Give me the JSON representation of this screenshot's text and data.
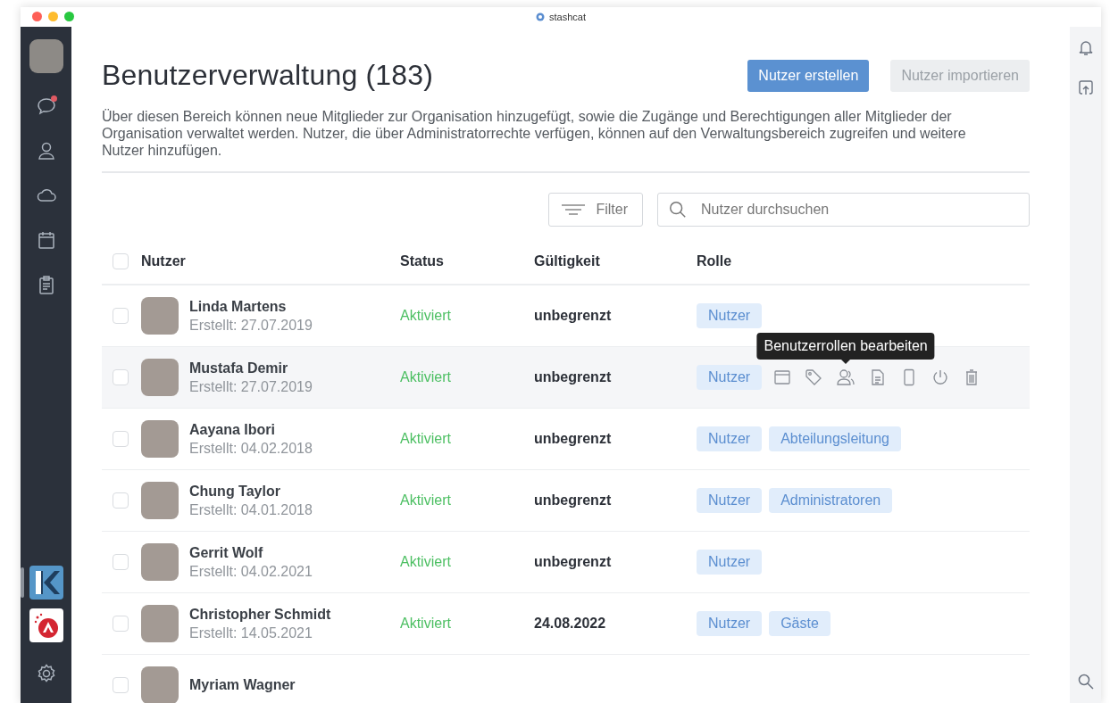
{
  "window": {
    "title": "stashcat"
  },
  "sidebar": {
    "items": [
      {
        "kind": "chat",
        "badge": true
      },
      {
        "kind": "contacts",
        "badge": false
      },
      {
        "kind": "cloud",
        "badge": false
      },
      {
        "kind": "calendar",
        "badge": false
      },
      {
        "kind": "clipboard",
        "badge": false
      }
    ],
    "apps": [
      {
        "kind": "k-logo",
        "selected": true
      },
      {
        "kind": "red-logo",
        "selected": false
      }
    ]
  },
  "page": {
    "title": "Benutzerverwaltung (183)",
    "description": "Über diesen Bereich können neue Mitglieder zur Organisation hinzugefügt, sowie die Zugänge und Berechtigungen aller Mitglieder der Organisation verwaltet werden. Nutzer, die über Administratorrechte verfügen, können auf den Verwaltungsbereich zugreifen und weitere Nutzer hinzufügen.",
    "buttons": [
      {
        "label": "Nutzer erstellen",
        "kind": "primary"
      },
      {
        "label": "Nutzer importieren",
        "kind": "secondary"
      }
    ],
    "filter": {
      "label": "Filter"
    },
    "search": {
      "placeholder": "Nutzer durchsuchen"
    }
  },
  "table": {
    "select_all_checked": false,
    "columns": [
      "Nutzer",
      "Status",
      "Gültigkeit",
      "Rolle"
    ],
    "rows": [
      {
        "name": "Linda Martens",
        "created": "Erstellt: 27.07.2019",
        "status": "Aktiviert",
        "validity": "unbegrenzt",
        "roles": [
          "Nutzer"
        ],
        "hovered": false,
        "checked": false
      },
      {
        "name": "Mustafa Demir",
        "created": "Erstellt: 27.07.2019",
        "status": "Aktiviert",
        "validity": "unbegrenzt",
        "roles": [
          "Nutzer"
        ],
        "hovered": true,
        "checked": false,
        "tooltip": "Benutzerrollen bearbeiten"
      },
      {
        "name": "Aayana Ibori",
        "created": "Erstellt: 04.02.2018",
        "status": "Aktiviert",
        "validity": "unbegrenzt",
        "roles": [
          "Nutzer",
          "Abteilungsleitung"
        ],
        "hovered": false,
        "checked": false
      },
      {
        "name": "Chung Taylor",
        "created": "Erstellt: 04.01.2018",
        "status": "Aktiviert",
        "validity": "unbegrenzt",
        "roles": [
          "Nutzer",
          "Administratoren"
        ],
        "hovered": false,
        "checked": false
      },
      {
        "name": "Gerrit Wolf",
        "created": "Erstellt: 04.02.2021",
        "status": "Aktiviert",
        "validity": "unbegrenzt",
        "roles": [
          "Nutzer"
        ],
        "hovered": false,
        "checked": false
      },
      {
        "name": "Christopher Schmidt",
        "created": "Erstellt: 14.05.2021",
        "status": "Aktiviert",
        "validity": "24.08.2022",
        "roles": [
          "Nutzer",
          "Gäste"
        ],
        "hovered": false,
        "checked": false
      },
      {
        "name": "Myriam Wagner",
        "hovered": false,
        "checked": false,
        "roles": []
      }
    ]
  }
}
